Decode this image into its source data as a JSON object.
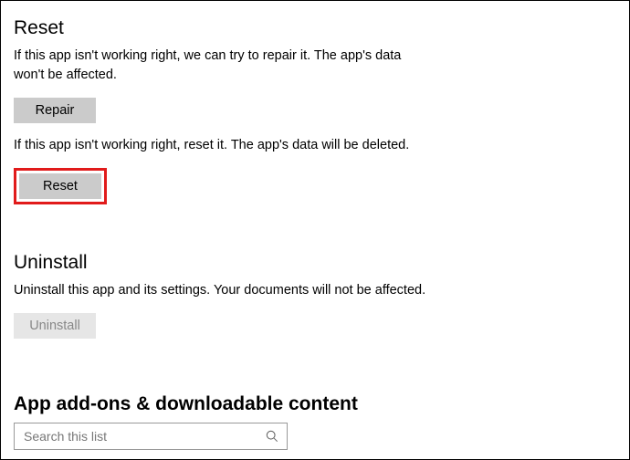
{
  "reset": {
    "title": "Reset",
    "repair_desc": "If this app isn't working right, we can try to repair it. The app's data won't be affected.",
    "repair_label": "Repair",
    "reset_desc": "If this app isn't working right, reset it. The app's data will be deleted.",
    "reset_label": "Reset"
  },
  "uninstall": {
    "title": "Uninstall",
    "desc": "Uninstall this app and its settings. Your documents will not be affected.",
    "button_label": "Uninstall"
  },
  "addons": {
    "title": "App add-ons & downloadable content",
    "search_placeholder": "Search this list"
  }
}
